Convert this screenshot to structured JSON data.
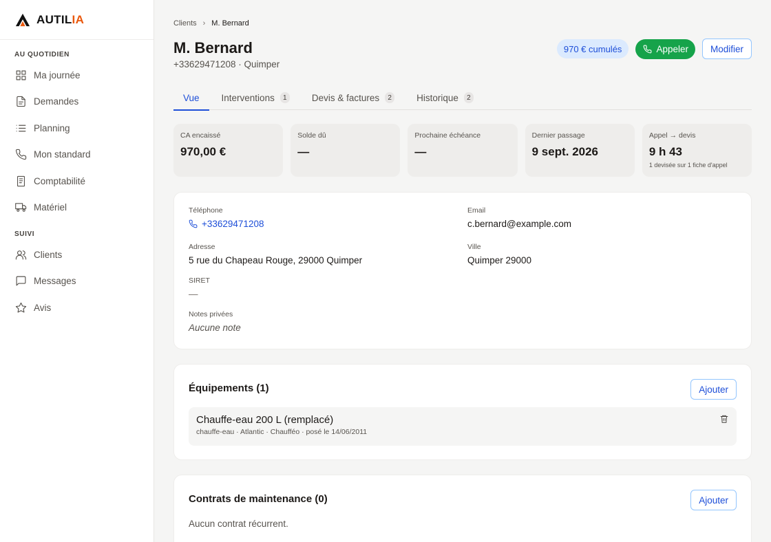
{
  "brand": {
    "name_main": "AUTIL",
    "name_accent": "IA"
  },
  "sidebar": {
    "sections": [
      {
        "label": "AU QUOTIDIEN",
        "items": [
          {
            "label": "Ma journée",
            "icon": "grid-icon"
          },
          {
            "label": "Demandes",
            "icon": "document-icon"
          },
          {
            "label": "Planning",
            "icon": "list-icon"
          },
          {
            "label": "Mon standard",
            "icon": "phone-icon"
          },
          {
            "label": "Comptabilité",
            "icon": "receipt-icon"
          },
          {
            "label": "Matériel",
            "icon": "truck-icon"
          }
        ]
      },
      {
        "label": "SUIVI",
        "items": [
          {
            "label": "Clients",
            "icon": "users-icon"
          },
          {
            "label": "Messages",
            "icon": "message-icon"
          },
          {
            "label": "Avis",
            "icon": "star-icon"
          }
        ]
      }
    ]
  },
  "breadcrumb": {
    "parent": "Clients",
    "current": "M. Bernard"
  },
  "header": {
    "title": "M. Bernard",
    "subtitle": "+33629471208 · Quimper",
    "cumul_badge": "970 € cumulés",
    "call_label": "Appeler",
    "edit_label": "Modifier"
  },
  "tabs": [
    {
      "label": "Vue",
      "count": null,
      "active": true
    },
    {
      "label": "Interventions",
      "count": "1"
    },
    {
      "label": "Devis & factures",
      "count": "2"
    },
    {
      "label": "Historique",
      "count": "2"
    }
  ],
  "stats": [
    {
      "label": "CA encaissé",
      "value": "970,00 €",
      "note": ""
    },
    {
      "label": "Solde dû",
      "value": "—",
      "note": ""
    },
    {
      "label": "Prochaine échéance",
      "value": "—",
      "note": ""
    },
    {
      "label": "Dernier passage",
      "value": "9 sept. 2026",
      "note": ""
    },
    {
      "label": "Appel → devis",
      "value": "9 h 43",
      "note": "1 devisée sur 1 fiche d'appel"
    }
  ],
  "info": {
    "phone_label": "Téléphone",
    "phone": "+33629471208",
    "email_label": "Email",
    "email": "c.bernard@example.com",
    "address_label": "Adresse",
    "address": "5 rue du Chapeau Rouge, 29000 Quimper",
    "city_label": "Ville",
    "city": "Quimper 29000",
    "siret_label": "SIRET",
    "siret": "—",
    "notes_label": "Notes privées",
    "notes": "Aucune note"
  },
  "equipments": {
    "title": "Équipements (1)",
    "add_label": "Ajouter",
    "items": [
      {
        "name": "Chauffe-eau 200 L (remplacé)",
        "meta": "chauffe-eau · Atlantic · Chaufféo · posé le 14/06/2011"
      }
    ]
  },
  "contracts": {
    "title": "Contrats de maintenance (0)",
    "add_label": "Ajouter",
    "empty": "Aucun contrat récurrent."
  },
  "colors": {
    "accent": "#1d4ed8",
    "call": "#16a34a",
    "brand_accent": "#ea580c"
  }
}
